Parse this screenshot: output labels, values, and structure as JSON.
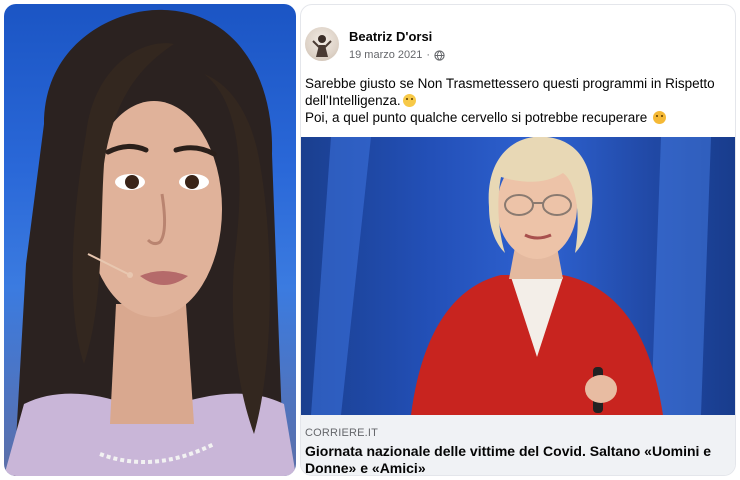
{
  "post": {
    "author": "Beatriz D'orsi",
    "date": "19 marzo 2021",
    "privacy_icon": "globe-icon",
    "text_line1": "Sarebbe giusto se Non Trasmettessero questi programmi in Rispetto dell'Intelligenza.",
    "text_line2": "Poi, a quel punto qualche cervello si potrebbe recuperare",
    "emoji1": "grimacing-face-emoji",
    "emoji2": "rolling-laughing-emoji"
  },
  "link_preview": {
    "source": "CORRIERE.IT",
    "headline": "Giornata nazionale delle vittime del Covid. Saltano «Uomini e Donne» e «Amici»"
  },
  "colors": {
    "left_bg": "#2a68d8",
    "article_bg": "#2350b8",
    "jacket": "#c8241f",
    "preview_bg": "#f0f2f5"
  }
}
